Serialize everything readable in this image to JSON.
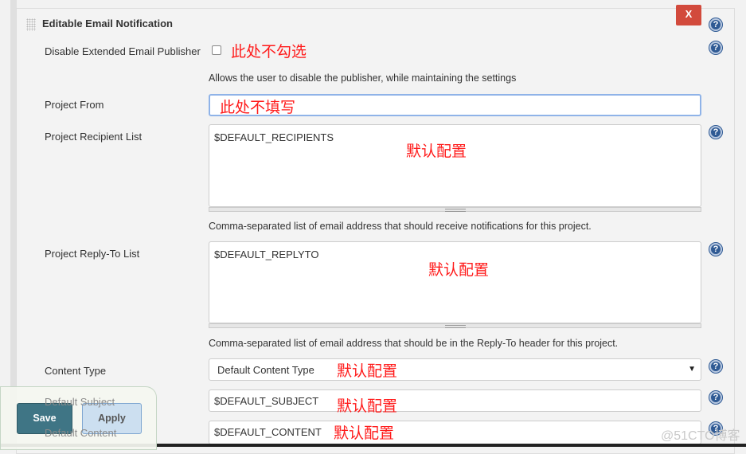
{
  "section": {
    "title": "Editable Email Notification",
    "close_label": "X"
  },
  "fields": {
    "disable": {
      "label": "Disable Extended Email Publisher",
      "checked": false,
      "note": "此处不勾选",
      "description": "Allows the user to disable the publisher, while maintaining the settings"
    },
    "project_from": {
      "label": "Project From",
      "value": "",
      "note": "此处不填写"
    },
    "recipients": {
      "label": "Project Recipient List",
      "value": "$DEFAULT_RECIPIENTS",
      "note": "默认配置",
      "description": "Comma-separated list of email address that should receive notifications for this project."
    },
    "reply_to": {
      "label": "Project Reply-To List",
      "value": "$DEFAULT_REPLYTO",
      "note": "默认配置",
      "description": "Comma-separated list of email address that should be in the Reply-To header for this project."
    },
    "content_type": {
      "label": "Content Type",
      "value": "Default Content Type",
      "note": "默认配置"
    },
    "subject": {
      "label": "Default Subject",
      "value": "$DEFAULT_SUBJECT",
      "note": "默认配置"
    },
    "content": {
      "label": "Default Content",
      "value": "$DEFAULT_CONTENT",
      "note": "默认配置"
    }
  },
  "buttons": {
    "save": "Save",
    "apply": "Apply"
  },
  "help_icon": "?",
  "watermark": "@51CTO博客"
}
